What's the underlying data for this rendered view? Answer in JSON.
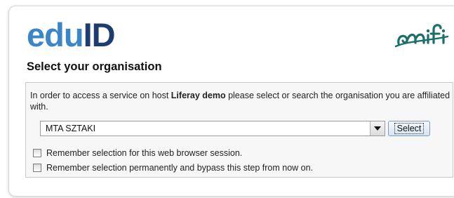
{
  "header": {
    "logo_part1": "edu",
    "logo_part2": "ID",
    "partner_logo_icon": "niif-logo"
  },
  "page_title": "Select your organisation",
  "description": {
    "prefix": "In order to access a service on host ",
    "host": "Liferay demo",
    "suffix": " please select or search the organisation you are affiliated with."
  },
  "organisation_select": {
    "selected_value": "MTA SZTAKI",
    "arrow_icon": "chevron-down-icon"
  },
  "select_button_label": "Select",
  "options": {
    "remember_session_label": "Remember selection for this web browser session.",
    "remember_session_checked": false,
    "remember_permanent_label": "Remember selection permanently and bypass this step from now on.",
    "remember_permanent_checked": false
  },
  "colors": {
    "edu_blue": "#3b86c9",
    "id_navy": "#1d3d6f",
    "niif_teal": "#1a6f6a"
  }
}
